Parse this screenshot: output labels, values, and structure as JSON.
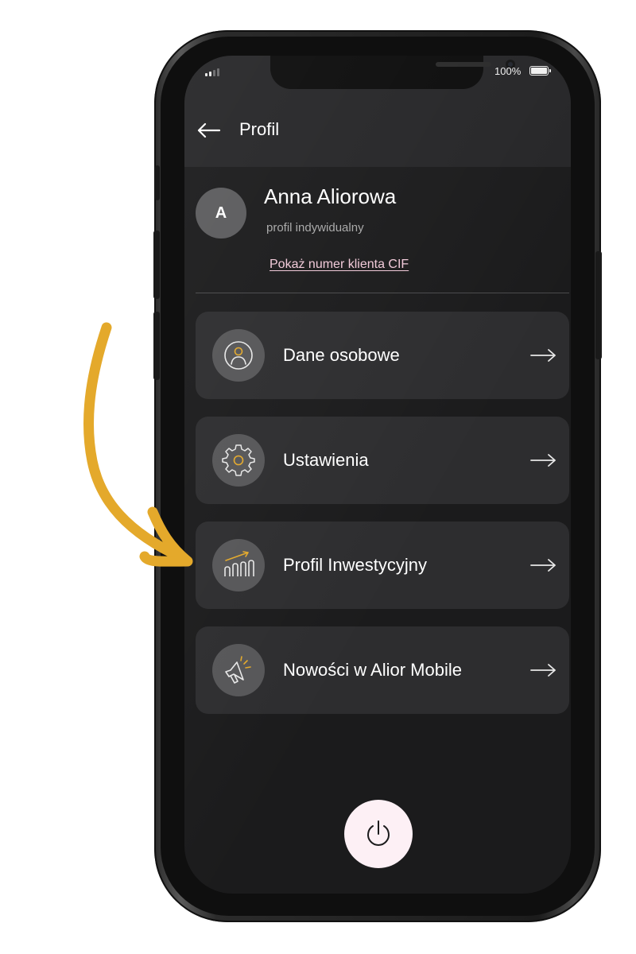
{
  "status_bar": {
    "battery_text": "100%"
  },
  "header": {
    "title": "Profil"
  },
  "profile": {
    "avatar_letter": "A",
    "name": "Anna Aliorowa",
    "type": "profil indywidualny",
    "cif_link": "Pokaż numer klienta CIF"
  },
  "menu": {
    "items": [
      {
        "label": "Dane osobowe",
        "icon": "person-icon"
      },
      {
        "label": "Ustawienia",
        "icon": "gear-icon"
      },
      {
        "label": "Profil Inwestycyjny",
        "icon": "investment-chart-icon"
      },
      {
        "label": "Nowości w Alior Mobile",
        "icon": "megaphone-icon"
      }
    ]
  },
  "logout": {
    "icon": "power-icon"
  },
  "colors": {
    "accent_gold": "#E4A92B",
    "link_pink": "#F1C9D8",
    "card_bg": "#2D2D2F",
    "screen_bg": "#1B1B1C"
  }
}
